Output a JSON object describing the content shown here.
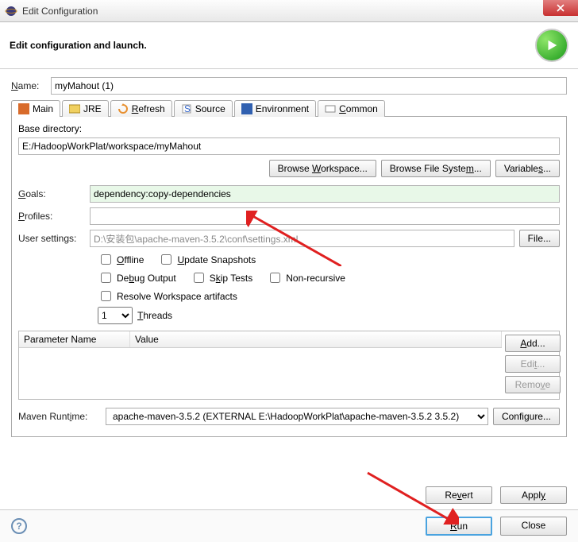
{
  "window": {
    "title": "Edit Configuration"
  },
  "header": {
    "message": "Edit configuration and launch."
  },
  "name": {
    "label": "Name:",
    "value": "myMahout (1)"
  },
  "tabs": [
    {
      "label": "Main"
    },
    {
      "label": "JRE"
    },
    {
      "label": "Refresh"
    },
    {
      "label": "Source"
    },
    {
      "label": "Environment"
    },
    {
      "label": "Common"
    }
  ],
  "main": {
    "base_dir_label": "Base directory:",
    "base_dir_value": "E:/HadoopWorkPlat/workspace/myMahout",
    "browse_workspace": "Browse Workspace...",
    "browse_filesystem": "Browse File System...",
    "variables": "Variables...",
    "goals_label": "Goals:",
    "goals_value": "dependency:copy-dependencies",
    "profiles_label": "Profiles:",
    "profiles_value": "",
    "user_settings_label": "User settings:",
    "user_settings_value": "D:\\安装包\\apache-maven-3.5.2\\conf\\settings.xml",
    "file_btn": "File...",
    "chk_offline": "Offline",
    "chk_update": "Update Snapshots",
    "chk_debug": "Debug Output",
    "chk_skip": "Skip Tests",
    "chk_nonrec": "Non-recursive",
    "chk_resolve": "Resolve Workspace artifacts",
    "threads_value": "1",
    "threads_label": "Threads",
    "table_col1": "Parameter Name",
    "table_col2": "Value",
    "add_btn": "Add...",
    "edit_btn": "Edit...",
    "remove_btn": "Remove",
    "runtime_label": "Maven Runtime:",
    "runtime_value": "apache-maven-3.5.2 (EXTERNAL E:\\HadoopWorkPlat\\apache-maven-3.5.2 3.5.2)",
    "configure_btn": "Configure..."
  },
  "buttons": {
    "revert": "Revert",
    "apply": "Apply",
    "run": "Run",
    "close": "Close"
  }
}
